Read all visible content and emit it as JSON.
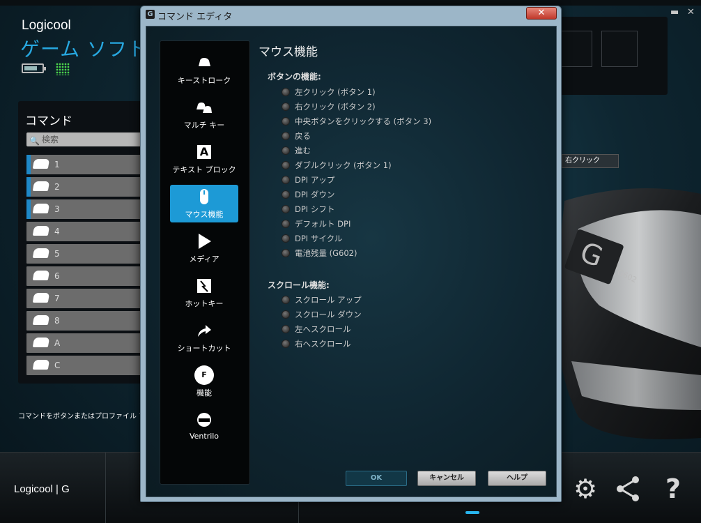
{
  "app": {
    "brand": "Logicool",
    "title": "ゲーム ソフトウ",
    "commands_title": "コマンド",
    "search_placeholder": "検索",
    "command_rows": [
      "1",
      "2",
      "3",
      "4",
      "5",
      "6",
      "7",
      "8",
      "A",
      "C"
    ],
    "hint": "コマンドをボタンまたはプロファイル アイ",
    "assign_label": "右クリック",
    "footer_brand": "Logicool | G",
    "mouse_model": "G602"
  },
  "dialog": {
    "title": "コマンド エディタ",
    "close": "✕",
    "sidebar": [
      {
        "label": "キーストローク",
        "icon": "key-icon"
      },
      {
        "label": "マルチ キー",
        "icon": "multi-key-icon"
      },
      {
        "label": "テキスト ブロック",
        "icon": "text-block-icon"
      },
      {
        "label": "マウス機能",
        "icon": "mouse-icon"
      },
      {
        "label": "メディア",
        "icon": "play-icon"
      },
      {
        "label": "ホットキー",
        "icon": "hotkey-icon"
      },
      {
        "label": "ショートカット",
        "icon": "shortcut-arrow-icon"
      },
      {
        "label": "機能",
        "icon": "function-gear-icon"
      },
      {
        "label": "Ventrilo",
        "icon": "ventrilo-icon"
      }
    ],
    "content_title": "マウス機能",
    "button_section": "ボタンの機能:",
    "button_options": [
      "左クリック (ボタン 1)",
      "右クリック (ボタン 2)",
      "中央ボタンをクリックする (ボタン 3)",
      "戻る",
      "進む",
      "ダブルクリック (ボタン 1)",
      "DPI アップ",
      "DPI ダウン",
      "DPI シフト",
      "デフォルト DPI",
      "DPI サイクル",
      "電池残量 (G602)"
    ],
    "scroll_section": "スクロール機能:",
    "scroll_options": [
      "スクロール アップ",
      "スクロール ダウン",
      "左へスクロール",
      "右へスクロール"
    ],
    "ok": "OK",
    "cancel": "キャンセル",
    "help": "ヘルプ"
  }
}
